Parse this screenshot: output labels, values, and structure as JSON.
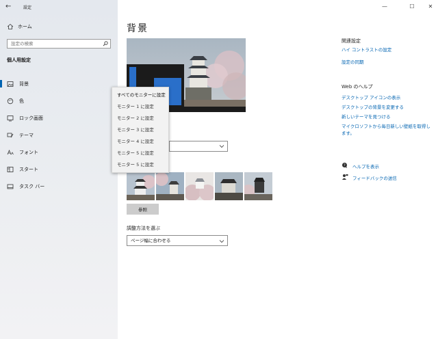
{
  "window": {
    "title": "設定",
    "back_glyph": "←",
    "minimize_glyph": "—",
    "maximize_glyph": "☐",
    "close_glyph": "✕"
  },
  "sidebar": {
    "home_label": "ホーム",
    "search_placeholder": "設定の検索",
    "section_label": "個人用設定",
    "items": [
      {
        "label": "背景",
        "icon": "picture-icon",
        "active": true
      },
      {
        "label": "色",
        "icon": "palette-icon",
        "active": false
      },
      {
        "label": "ロック画面",
        "icon": "lock-screen-icon",
        "active": false
      },
      {
        "label": "テーマ",
        "icon": "theme-brush-icon",
        "active": false
      },
      {
        "label": "フォント",
        "icon": "font-icon",
        "active": false
      },
      {
        "label": "スタート",
        "icon": "start-icon",
        "active": false
      },
      {
        "label": "タスク バー",
        "icon": "taskbar-icon",
        "active": false
      }
    ]
  },
  "main": {
    "title": "背景",
    "monitor_menu": {
      "items": [
        "すべてのモニターに設定",
        "モニター 1 に設定",
        "モニター 2 に設定",
        "モニター 3 に設定",
        "モニター 4 に設定",
        "モニター 5 に設定",
        "モニター 5 に設定"
      ]
    },
    "browse_label": "参照",
    "fit_label": "調整方法を選ぶ",
    "fit_value": "ページ幅に合わせる",
    "thumbnails": [
      {
        "name": "castle-photo-1"
      },
      {
        "name": "castle-photo-2"
      },
      {
        "name": "castle-photo-3"
      },
      {
        "name": "castle-photo-4"
      },
      {
        "name": "castle-photo-5"
      }
    ]
  },
  "related": {
    "heading": "関連設定",
    "links": [
      "ハイ コントラストの設定",
      "設定の同期"
    ]
  },
  "web_help": {
    "heading": "Web のヘルプ",
    "links": [
      "デスクトップ アイコンの表示",
      "デスクトップの背景を変更する",
      "新しいテーマを見つける",
      "マイクロソフトから毎日新しい壁紙を取得します。"
    ]
  },
  "support": {
    "help_label": "ヘルプを表示",
    "feedback_label": "フィードバックの送信"
  },
  "colors": {
    "accent": "#0063b1",
    "sidebar_bg": "#e6e9ee",
    "menu_bg": "#f2f2f2"
  }
}
